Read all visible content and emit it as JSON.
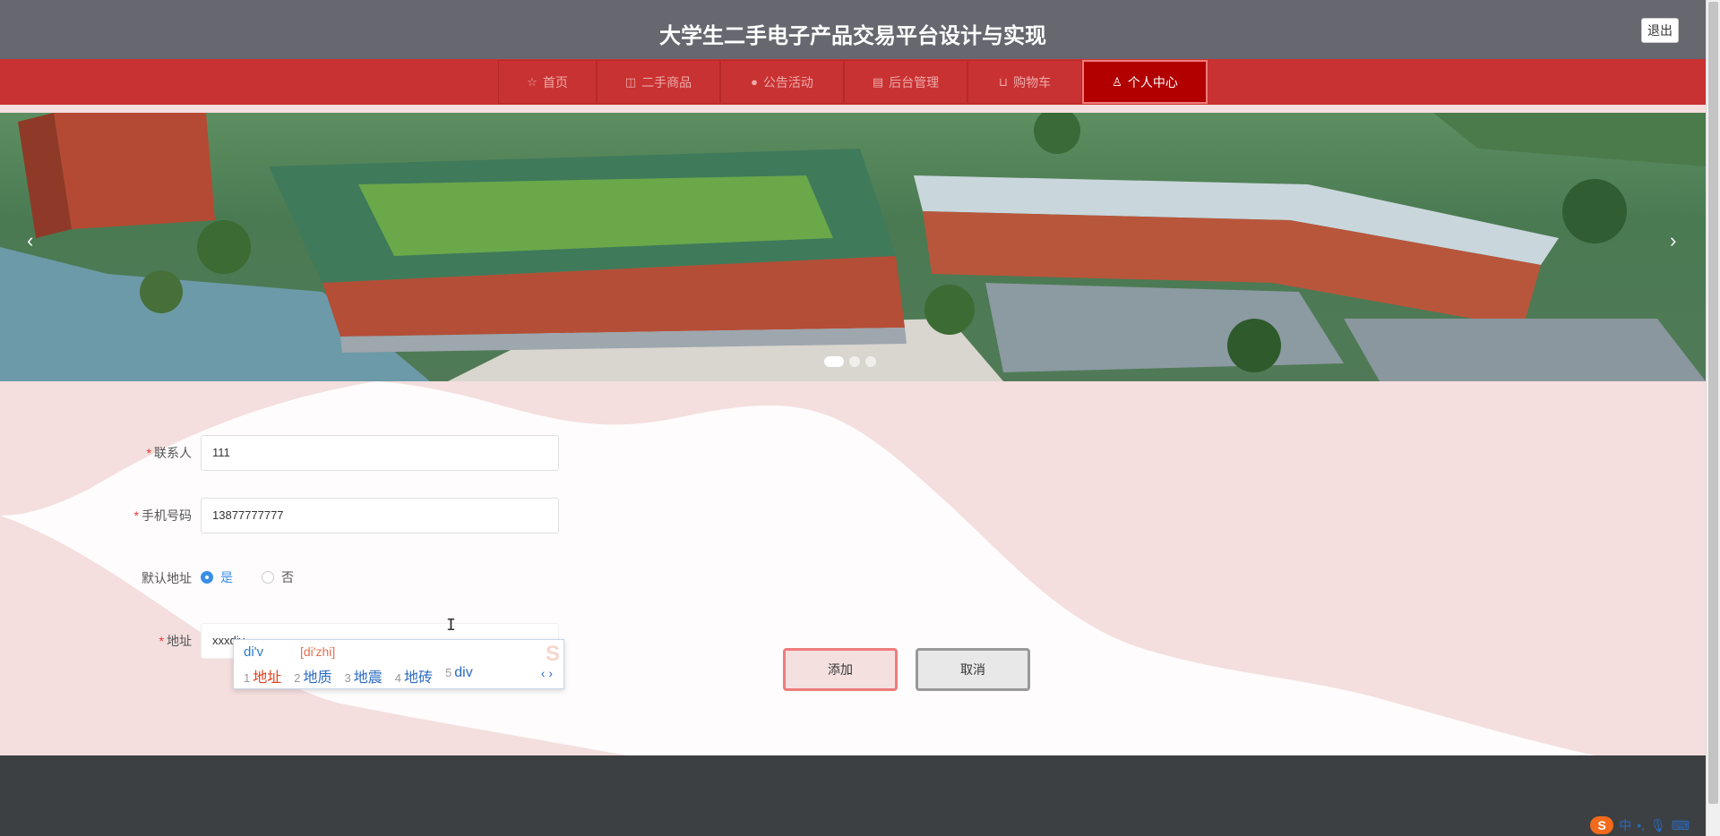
{
  "header": {
    "title": "大学生二手电子产品交易平台设计与实现",
    "logout_label": "退出"
  },
  "nav": {
    "items": [
      {
        "label": "首页",
        "icon": "star-icon",
        "glyph": "☆"
      },
      {
        "label": "二手商品",
        "icon": "bag-icon",
        "glyph": "◫"
      },
      {
        "label": "公告活动",
        "icon": "info-icon",
        "glyph": "●"
      },
      {
        "label": "后台管理",
        "icon": "building-icon",
        "glyph": "▤"
      },
      {
        "label": "购物车",
        "icon": "cart-icon",
        "glyph": "⊔"
      },
      {
        "label": "个人中心",
        "icon": "user-icon",
        "glyph": "♙",
        "active": true
      }
    ]
  },
  "banner": {
    "prev_glyph": "‹",
    "next_glyph": "›",
    "slide_count": 3,
    "active_slide": 1
  },
  "form": {
    "contact_label": "联系人",
    "contact_value": "111",
    "phone_label": "手机号码",
    "phone_value": "13877777777",
    "default_label": "默认地址",
    "default_yes": "是",
    "default_no": "否",
    "default_selected": "是",
    "address_label": "地址",
    "address_value": "xxxdiv",
    "required_mark": "*",
    "add_button": "添加",
    "cancel_button": "取消"
  },
  "ime": {
    "pinyin": "di'v",
    "hint": "[di'zhi]",
    "candidates": [
      {
        "n": "1",
        "text": "地址"
      },
      {
        "n": "2",
        "text": "地质"
      },
      {
        "n": "3",
        "text": "地震"
      },
      {
        "n": "4",
        "text": "地砖"
      },
      {
        "n": "5",
        "text": "div"
      }
    ],
    "nav": "‹ ›",
    "logo": "S"
  },
  "tray": {
    "logo": "S",
    "mode": "中",
    "punct": "•,",
    "mic": "🎙",
    "keyboard": "⌨"
  },
  "colors": {
    "header_bg": "#676770",
    "nav_bg": "#c93232",
    "nav_active_bg": "#b20000",
    "content_bg": "#f4dede",
    "footer_bg": "#3d4043",
    "radio_accent": "#3a8ee6"
  }
}
